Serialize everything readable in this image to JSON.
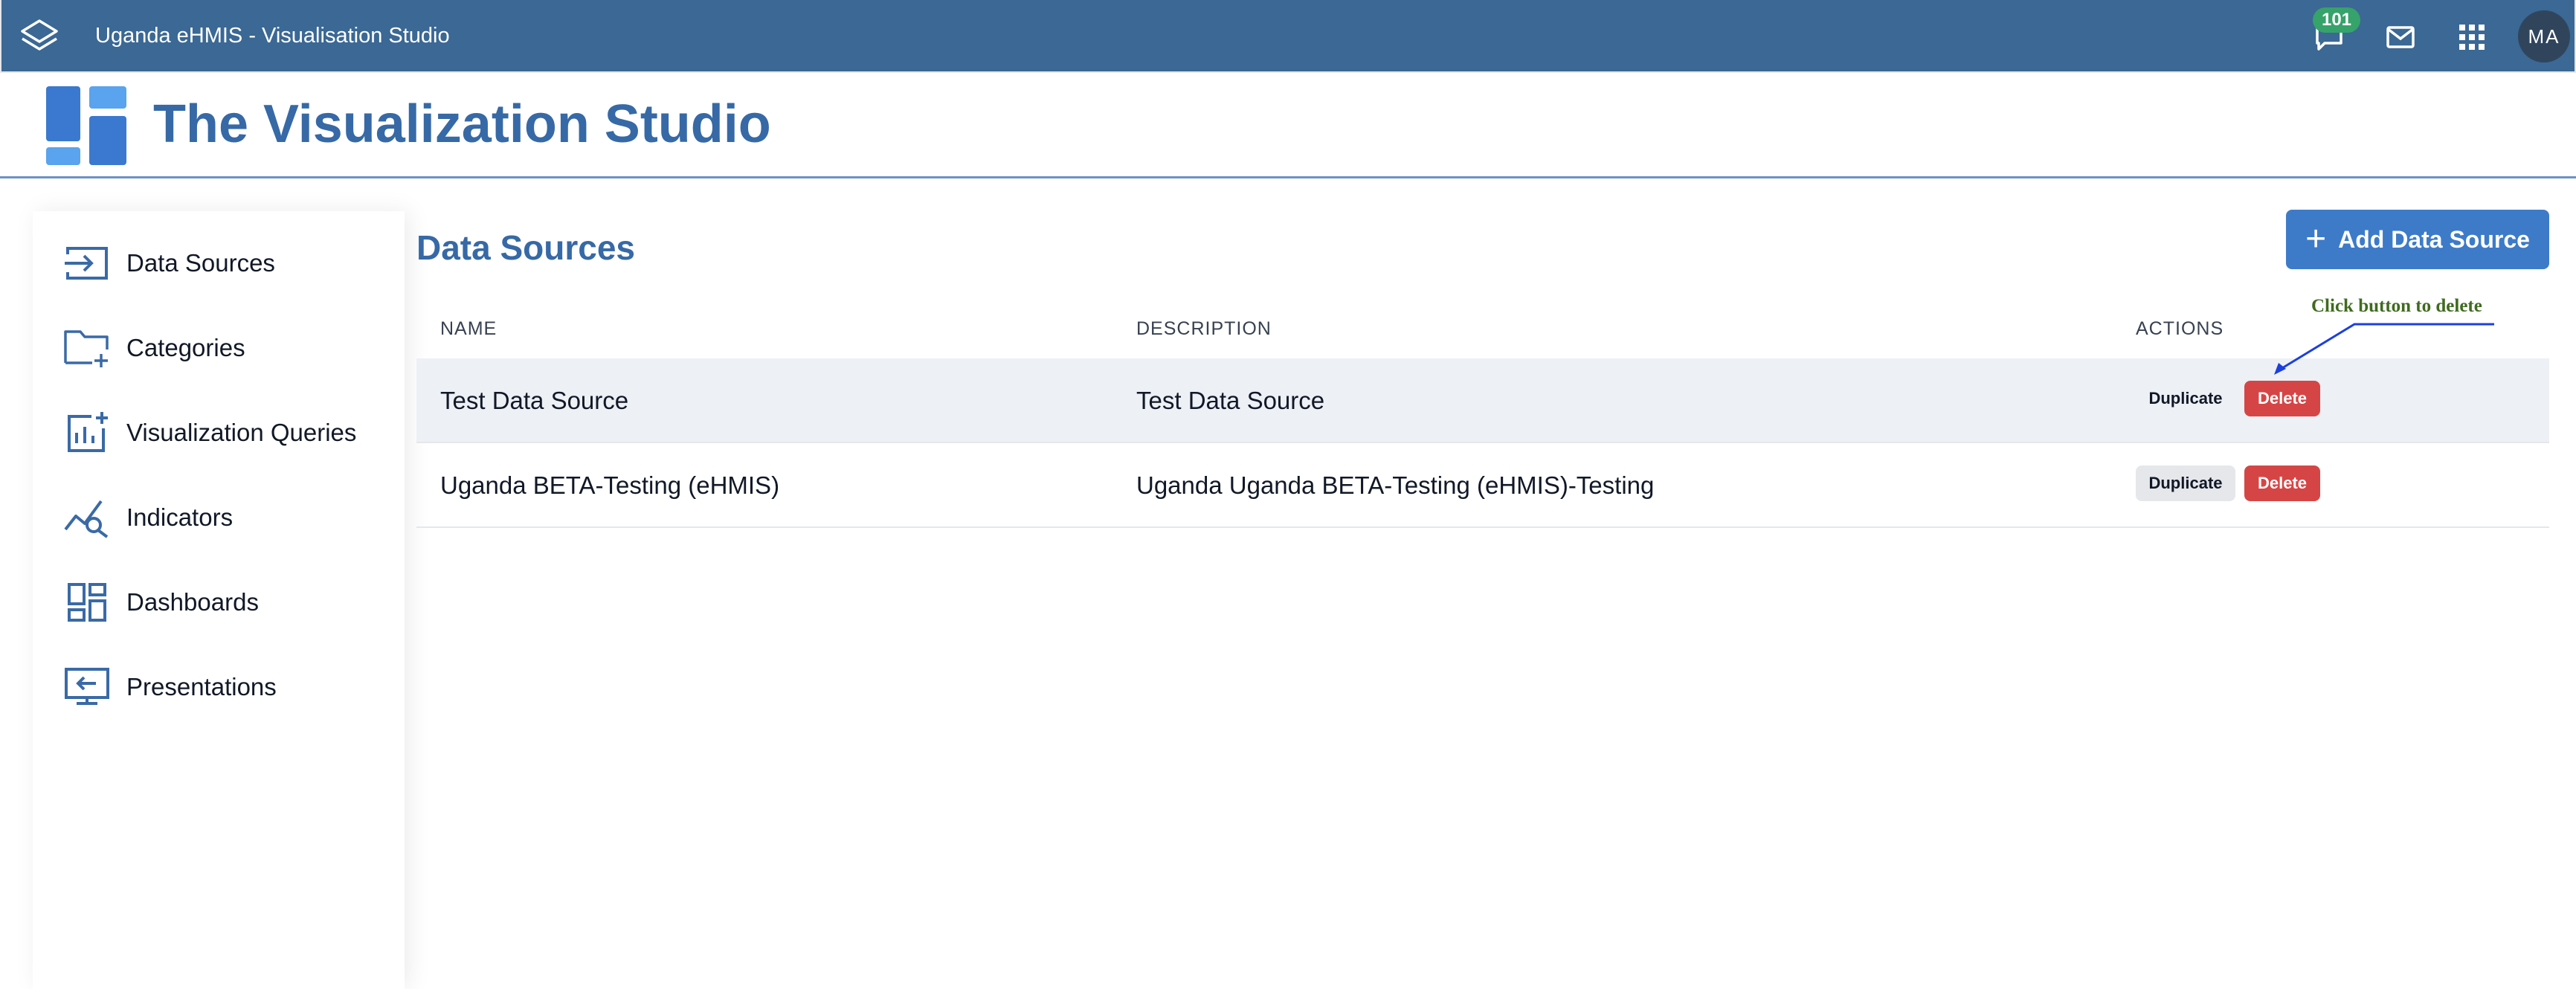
{
  "header": {
    "app_title": "Uganda eHMIS - Visualisation Studio",
    "logo_icon": "layers-icon",
    "notification_count": "101",
    "icons": [
      "chat-icon",
      "mail-icon",
      "apps-grid-icon"
    ],
    "avatar_initials": "MA",
    "background_color": "#3b6894"
  },
  "studio": {
    "title": "The Visualization Studio",
    "logo_icon": "dashboard-tiles-icon",
    "accent_color": "#3669a6"
  },
  "sidebar": {
    "items": [
      {
        "label": "Data Sources",
        "icon": "input-arrow-icon"
      },
      {
        "label": "Categories",
        "icon": "folder-add-icon"
      },
      {
        "label": "Visualization Queries",
        "icon": "chart-add-icon"
      },
      {
        "label": "Indicators",
        "icon": "query-stats-icon"
      },
      {
        "label": "Dashboards",
        "icon": "dashboard-icon"
      },
      {
        "label": "Presentations",
        "icon": "presentation-icon"
      }
    ]
  },
  "main": {
    "heading": "Data Sources",
    "add_button_label": "Add Data Source",
    "columns": {
      "name": "NAME",
      "description": "DESCRIPTION",
      "actions": "ACTIONS"
    },
    "rows": [
      {
        "name": "Test Data Source",
        "description": "Test Data Source",
        "duplicate_label": "Duplicate",
        "delete_label": "Delete"
      },
      {
        "name": "Uganda BETA-Testing (eHMIS)",
        "description": "Uganda Uganda BETA-Testing (eHMIS)-Testing",
        "duplicate_label": "Duplicate",
        "delete_label": "Delete"
      }
    ]
  },
  "annotation": {
    "text": "Click button to delete",
    "text_color": "#3f6b1f",
    "arrow_color": "#1b3fe0"
  }
}
